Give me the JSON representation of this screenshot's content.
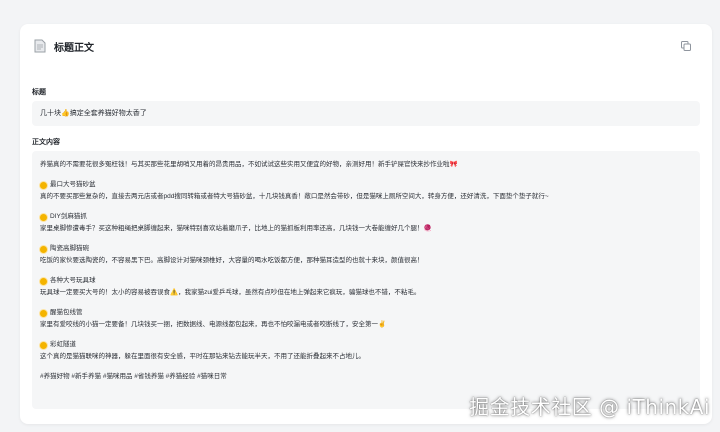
{
  "card": {
    "title": "标题正文",
    "icons": {
      "header": "document-icon",
      "copy": "copy-icon"
    }
  },
  "title_field": {
    "label": "标题",
    "value": "几十块👍搞定全套养猫好物太香了"
  },
  "body_field": {
    "label": "正文内容",
    "intro": "养猫真的不需要花很多冤枉钱！与其买那些花里胡哨又用着的昂贵用品，不如试试这些实用又便宜的好物，亲测好用！新手铲屎官快来抄作业啦🎀",
    "sections": [
      {
        "heading": "最口大号猫砂盆",
        "text": "真的不要买那些复杂的，直接去两元店或者pdd搜同转箱或者特大号猫砂盆，十几块钱真香！敞口是然会带砂，但是猫咪上厕所空间大，转身方便，还好清洗，下面垫个垫子就行~"
      },
      {
        "heading": "DIY剑麻猫抓",
        "text": "家里桌脚惨遭毒手？买这种粗绳把桌脚缠起来，猫咪特别喜欢站着磨爪子，比地上的猫抓板利用率还高，几块钱一大卷能缠好几个腿！🧶"
      },
      {
        "heading": "陶瓷高脚猫碗",
        "text": "吃饭的家伙要选陶瓷的，不容易黑下巴。高脚设计对猫咪颈椎好，大容量的喝水吃饭都方便，那种猫耳造型的也就十来块，颜值很高！"
      },
      {
        "heading": "各种大号玩具球",
        "text": "玩具球一定要买大号的！太小的容易被吞误食⚠️，我家猫zui爱乒乓球，虽然有点吵但在地上弹起来它疯玩，骗猫球也不错，不粘毛。"
      },
      {
        "heading": "醒猫包线管",
        "text": "家里有爱咬线的小猫一定要备！几块钱买一捆，把数据线、电源线都包起来，再也不怕咬漏电或者咬断线了，安全第一✌️"
      },
      {
        "heading": "彩虹隧道",
        "text": "这个真的是猫猫联咪的神器，躲在里面很有安全感，平时在那钻来钻去能玩半天，不用了还能折叠起来不占地儿。"
      }
    ],
    "tags": "#养猫好物 #新手养猫 #猫咪用品 #省钱养猫 #养猫经验 #猫咪日常"
  },
  "watermark": "掘金技术社区 @ iThinkAi",
  "colors": {
    "page_bg": "#f3f4f6",
    "card_bg": "#ffffff",
    "field_bg": "#f5f6f7",
    "bullet": "#f4b400"
  }
}
